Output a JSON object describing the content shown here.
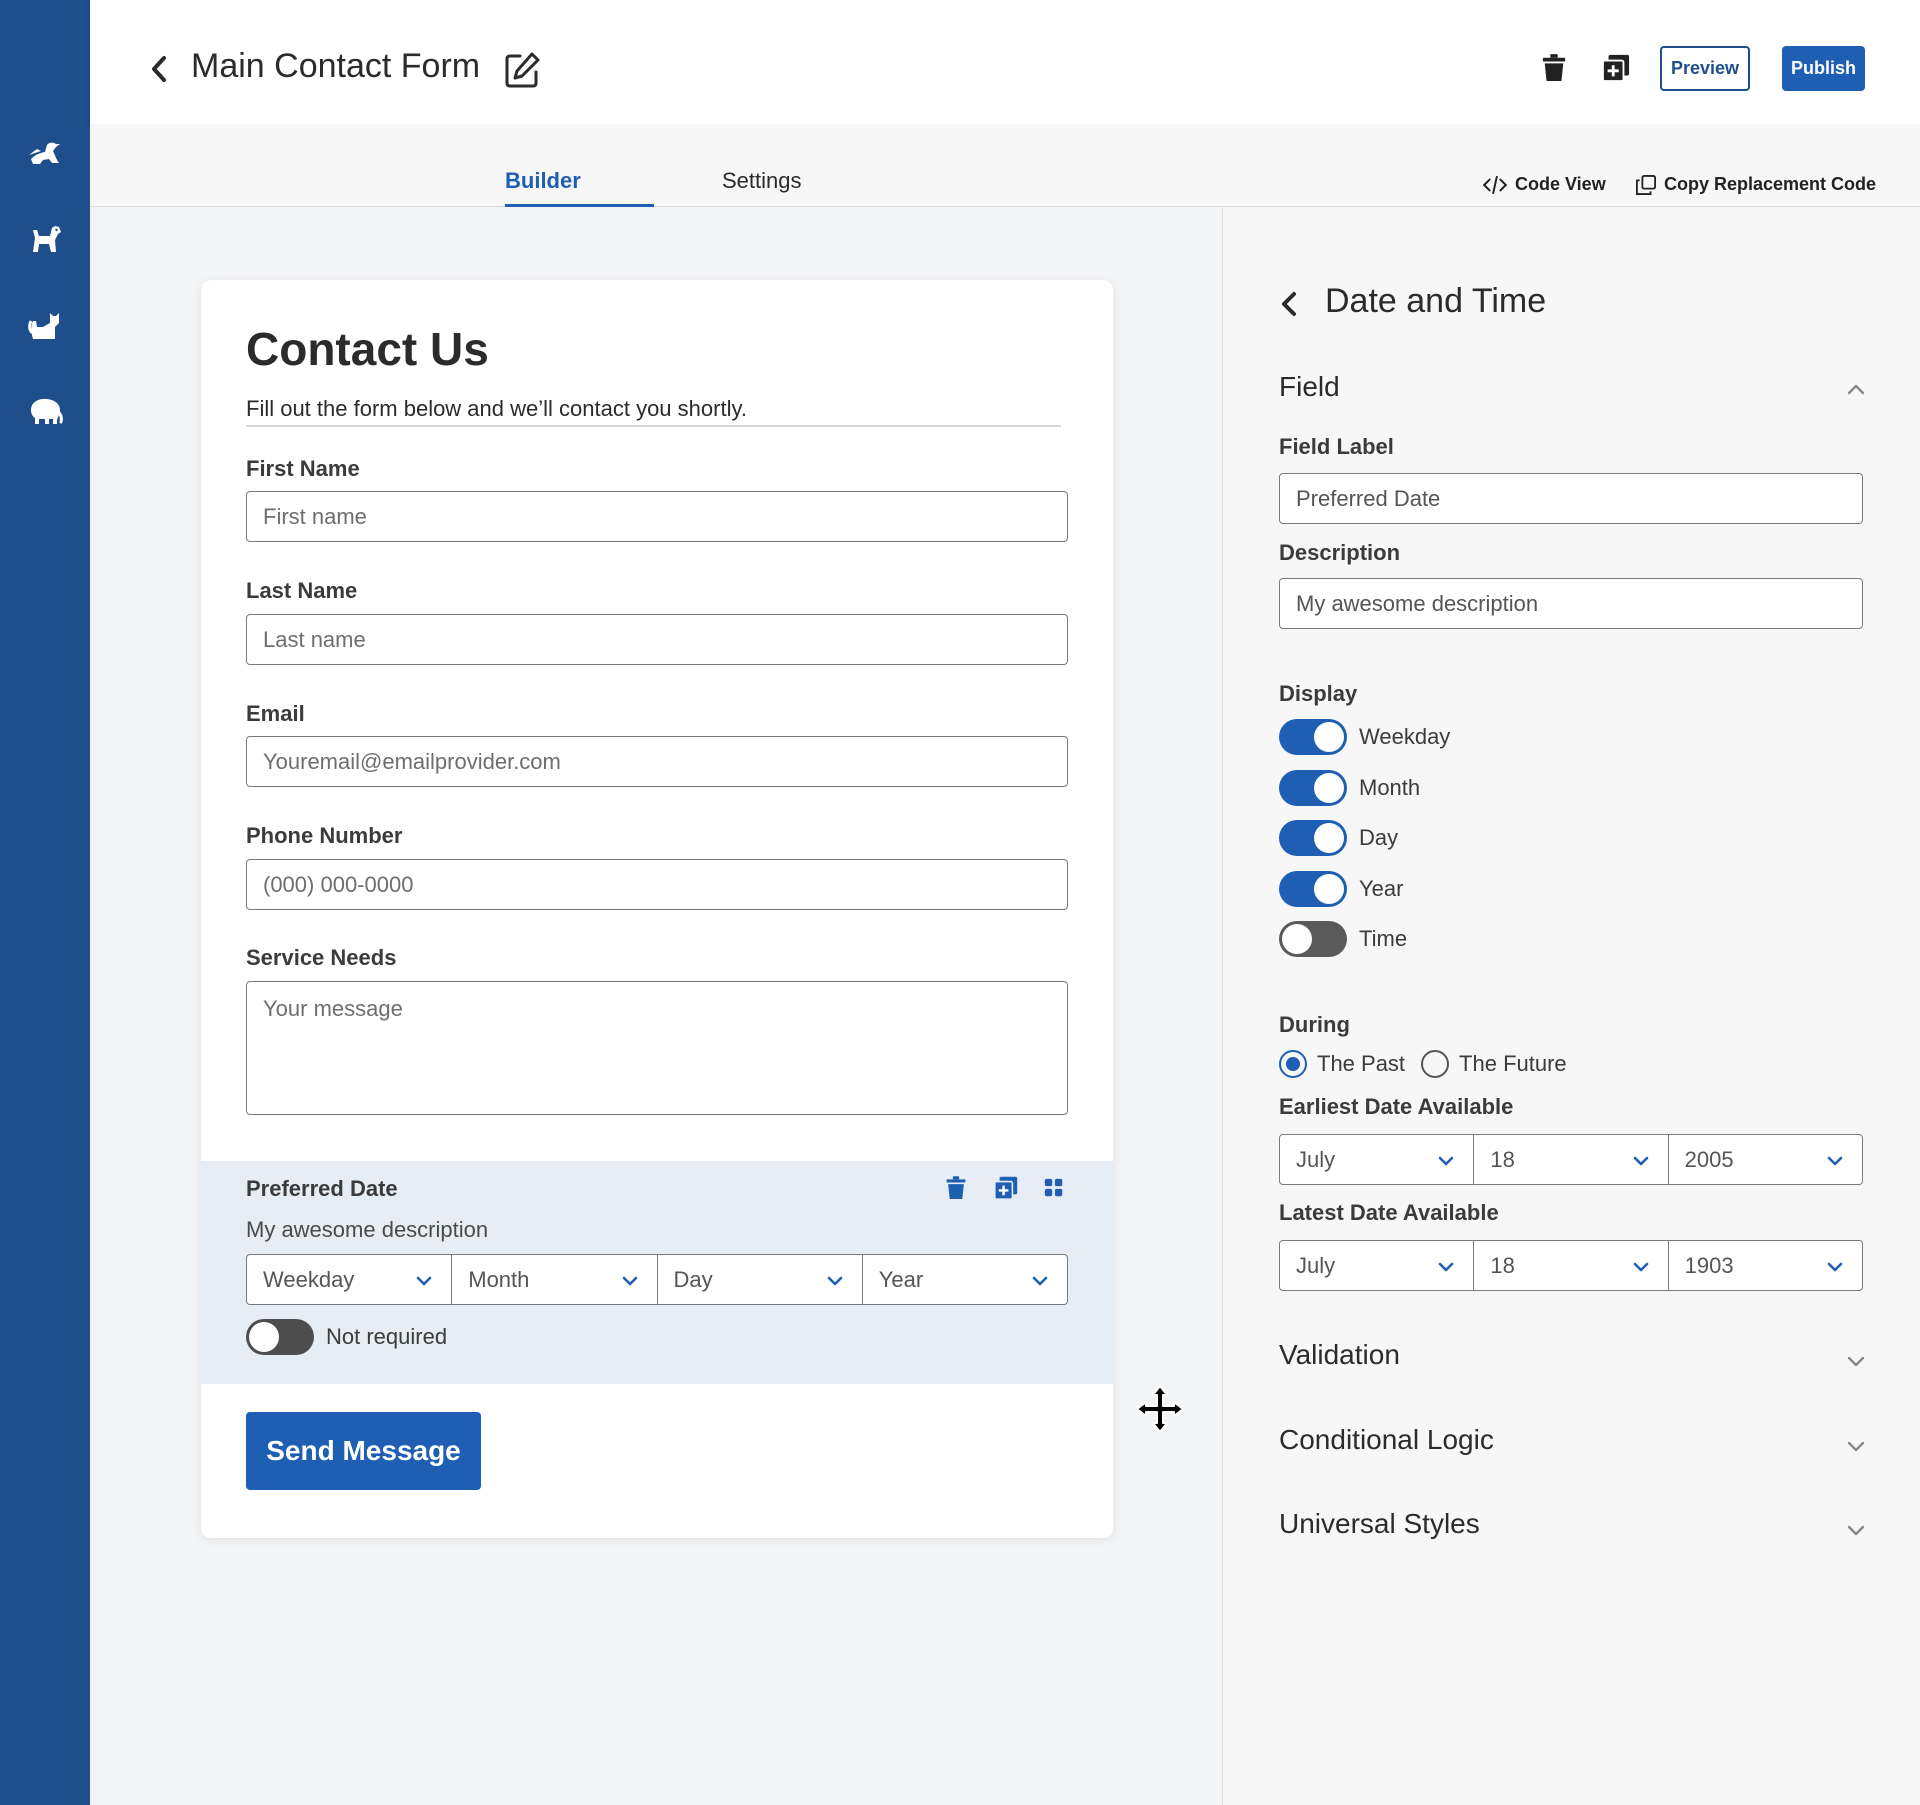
{
  "rail": {
    "items": [
      {
        "icon": "bird-icon"
      },
      {
        "icon": "dog-icon"
      },
      {
        "icon": "cat-icon"
      },
      {
        "icon": "elephant-icon"
      }
    ]
  },
  "header": {
    "title": "Main Contact Form",
    "preview_label": "Preview",
    "publish_label": "Publish"
  },
  "tabs": {
    "builder": "Builder",
    "settings": "Settings",
    "code_view": "Code View",
    "copy_code": "Copy Replacement Code"
  },
  "form": {
    "title": "Contact Us",
    "subtitle": "Fill out the form below and we’ll contact you shortly.",
    "fields": {
      "first_name": {
        "label": "First Name",
        "placeholder": "First name"
      },
      "last_name": {
        "label": "Last Name",
        "placeholder": "Last name"
      },
      "email": {
        "label": "Email",
        "placeholder": "Youremail@emailprovider.com"
      },
      "phone": {
        "label": "Phone Number",
        "placeholder": "(000) 000-0000"
      },
      "service": {
        "label": "Service Needs",
        "placeholder": "Your message"
      }
    },
    "date_field": {
      "label": "Preferred Date",
      "description": "My awesome description",
      "selects": [
        "Weekday",
        "Month",
        "Day",
        "Year"
      ],
      "required_label": "Not required"
    },
    "submit_label": "Send Message"
  },
  "panel": {
    "title": "Date and Time",
    "field_section": "Field",
    "field_label_label": "Field Label",
    "field_label_value": "Preferred Date",
    "description_label": "Description",
    "description_value": "My awesome description",
    "display_label": "Display",
    "display_options": [
      {
        "label": "Weekday",
        "on": true
      },
      {
        "label": "Month",
        "on": true
      },
      {
        "label": "Day",
        "on": true
      },
      {
        "label": "Year",
        "on": true
      },
      {
        "label": "Time",
        "on": false
      }
    ],
    "during_label": "During",
    "during_past": "The Past",
    "during_future": "The Future",
    "during_selected": "The Past",
    "earliest_label": "Earliest Date Available",
    "earliest": {
      "month": "July",
      "day": "18",
      "year": "2005"
    },
    "latest_label": "Latest Date Available",
    "latest": {
      "month": "July",
      "day": "18",
      "year": "1903"
    },
    "validation": "Validation",
    "conditional_logic": "Conditional Logic",
    "universal_styles": "Universal Styles"
  },
  "colors": {
    "rail": "#1f4e8c",
    "accent": "#1f5fb3",
    "selected_field_bg": "#e6edf5"
  }
}
